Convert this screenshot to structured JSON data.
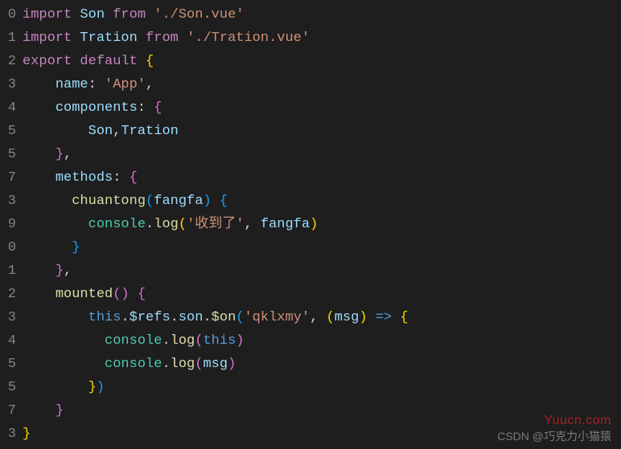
{
  "gutter_visible_digits": [
    "0",
    "1",
    "2",
    "3",
    "4",
    "5",
    "5",
    "7",
    "3",
    "9",
    "0",
    "1",
    "2",
    "3",
    "4",
    "5",
    "5",
    "7",
    "3"
  ],
  "lines": [
    [
      {
        "t": "import",
        "c": "c-keyword"
      },
      {
        "t": " ",
        "c": "c-default"
      },
      {
        "t": "Son",
        "c": "c-ident"
      },
      {
        "t": " ",
        "c": "c-default"
      },
      {
        "t": "from",
        "c": "c-keyword"
      },
      {
        "t": " ",
        "c": "c-default"
      },
      {
        "t": "'./Son.vue'",
        "c": "c-string"
      }
    ],
    [
      {
        "t": "import",
        "c": "c-keyword"
      },
      {
        "t": " ",
        "c": "c-default"
      },
      {
        "t": "Tration",
        "c": "c-ident"
      },
      {
        "t": " ",
        "c": "c-default"
      },
      {
        "t": "from",
        "c": "c-keyword"
      },
      {
        "t": " ",
        "c": "c-default"
      },
      {
        "t": "'./Tration.vue'",
        "c": "c-string"
      }
    ],
    [
      {
        "t": "export",
        "c": "c-keyword"
      },
      {
        "t": " ",
        "c": "c-default"
      },
      {
        "t": "default",
        "c": "c-keyword"
      },
      {
        "t": " ",
        "c": "c-default"
      },
      {
        "t": "{",
        "c": "c-brace-y"
      }
    ],
    [
      {
        "t": "    ",
        "c": "c-default"
      },
      {
        "t": "name",
        "c": "c-ident"
      },
      {
        "t": ": ",
        "c": "c-default"
      },
      {
        "t": "'App'",
        "c": "c-string"
      },
      {
        "t": ",",
        "c": "c-default"
      }
    ],
    [
      {
        "t": "    ",
        "c": "c-default"
      },
      {
        "t": "components",
        "c": "c-ident"
      },
      {
        "t": ": ",
        "c": "c-default"
      },
      {
        "t": "{",
        "c": "c-brace-p"
      }
    ],
    [
      {
        "t": "        ",
        "c": "c-default"
      },
      {
        "t": "Son",
        "c": "c-ident"
      },
      {
        "t": ",",
        "c": "c-default"
      },
      {
        "t": "Tration",
        "c": "c-ident"
      }
    ],
    [
      {
        "t": "    ",
        "c": "c-default"
      },
      {
        "t": "}",
        "c": "c-brace-p"
      },
      {
        "t": ",",
        "c": "c-default"
      }
    ],
    [
      {
        "t": "    ",
        "c": "c-default"
      },
      {
        "t": "methods",
        "c": "c-ident"
      },
      {
        "t": ": ",
        "c": "c-default"
      },
      {
        "t": "{",
        "c": "c-brace-p"
      }
    ],
    [
      {
        "t": "      ",
        "c": "c-default"
      },
      {
        "t": "chuantong",
        "c": "c-func"
      },
      {
        "t": "(",
        "c": "c-brace-b"
      },
      {
        "t": "fangfa",
        "c": "c-ident"
      },
      {
        "t": ")",
        "c": "c-brace-b"
      },
      {
        "t": " ",
        "c": "c-default"
      },
      {
        "t": "{",
        "c": "c-brace-b"
      }
    ],
    [
      {
        "t": "        ",
        "c": "c-default"
      },
      {
        "t": "console",
        "c": "c-obj"
      },
      {
        "t": ".",
        "c": "c-default"
      },
      {
        "t": "log",
        "c": "c-func"
      },
      {
        "t": "(",
        "c": "c-brace-y"
      },
      {
        "t": "'收到了'",
        "c": "c-string"
      },
      {
        "t": ", ",
        "c": "c-default"
      },
      {
        "t": "fangfa",
        "c": "c-ident"
      },
      {
        "t": ")",
        "c": "c-brace-y"
      }
    ],
    [
      {
        "t": "      ",
        "c": "c-default"
      },
      {
        "t": "}",
        "c": "c-brace-b"
      }
    ],
    [
      {
        "t": "    ",
        "c": "c-default"
      },
      {
        "t": "}",
        "c": "c-brace-p"
      },
      {
        "t": ",",
        "c": "c-default"
      }
    ],
    [
      {
        "t": "    ",
        "c": "c-default"
      },
      {
        "t": "mounted",
        "c": "c-func"
      },
      {
        "t": "()",
        "c": "c-brace-p"
      },
      {
        "t": " ",
        "c": "c-default"
      },
      {
        "t": "{",
        "c": "c-brace-p"
      }
    ],
    [
      {
        "t": "        ",
        "c": "c-default"
      },
      {
        "t": "this",
        "c": "c-this"
      },
      {
        "t": ".",
        "c": "c-default"
      },
      {
        "t": "$refs",
        "c": "c-ident"
      },
      {
        "t": ".",
        "c": "c-default"
      },
      {
        "t": "son",
        "c": "c-ident"
      },
      {
        "t": ".",
        "c": "c-default"
      },
      {
        "t": "$on",
        "c": "c-func"
      },
      {
        "t": "(",
        "c": "c-brace-b"
      },
      {
        "t": "'qklxmy'",
        "c": "c-string"
      },
      {
        "t": ", ",
        "c": "c-default"
      },
      {
        "t": "(",
        "c": "c-brace-y"
      },
      {
        "t": "msg",
        "c": "c-ident"
      },
      {
        "t": ")",
        "c": "c-brace-y"
      },
      {
        "t": " ",
        "c": "c-default"
      },
      {
        "t": "=>",
        "c": "c-this"
      },
      {
        "t": " ",
        "c": "c-default"
      },
      {
        "t": "{",
        "c": "c-brace-y"
      }
    ],
    [
      {
        "t": "          ",
        "c": "c-default"
      },
      {
        "t": "console",
        "c": "c-obj"
      },
      {
        "t": ".",
        "c": "c-default"
      },
      {
        "t": "log",
        "c": "c-func"
      },
      {
        "t": "(",
        "c": "c-brace-p"
      },
      {
        "t": "this",
        "c": "c-this"
      },
      {
        "t": ")",
        "c": "c-brace-p"
      }
    ],
    [
      {
        "t": "          ",
        "c": "c-default"
      },
      {
        "t": "console",
        "c": "c-obj"
      },
      {
        "t": ".",
        "c": "c-default"
      },
      {
        "t": "log",
        "c": "c-func"
      },
      {
        "t": "(",
        "c": "c-brace-p"
      },
      {
        "t": "msg",
        "c": "c-ident"
      },
      {
        "t": ")",
        "c": "c-brace-p"
      }
    ],
    [
      {
        "t": "        ",
        "c": "c-default"
      },
      {
        "t": "}",
        "c": "c-brace-y"
      },
      {
        "t": ")",
        "c": "c-brace-b"
      }
    ],
    [
      {
        "t": "    ",
        "c": "c-default"
      },
      {
        "t": "}",
        "c": "c-brace-p"
      }
    ],
    [
      {
        "t": "}",
        "c": "c-brace-y"
      }
    ]
  ],
  "watermark_main": "Yuucn.com",
  "watermark_sub": "CSDN @巧克力小猫猿"
}
